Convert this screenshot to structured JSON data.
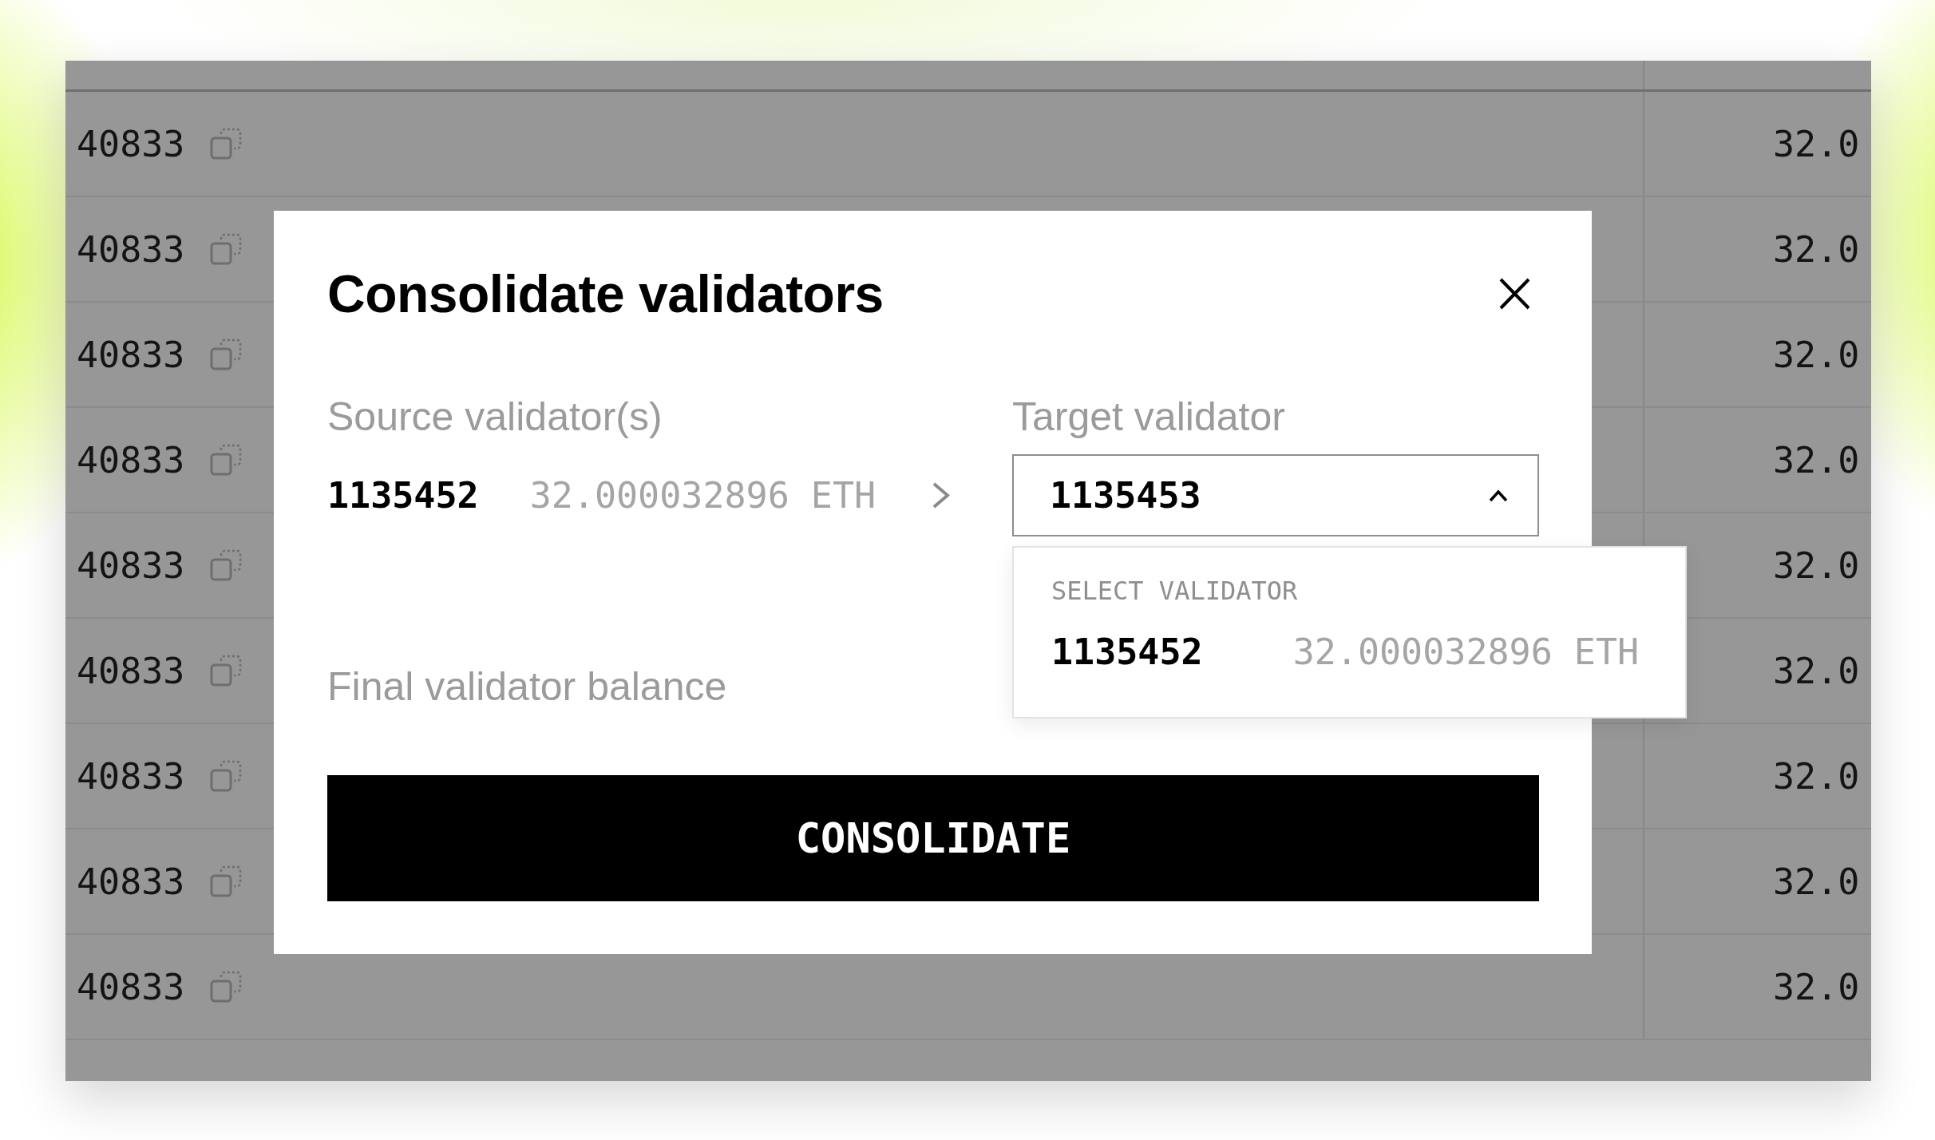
{
  "table": {
    "rows": [
      {
        "column_1": "40833",
        "column_2": "32.0"
      },
      {
        "column_1": "40833",
        "column_2": "32.0"
      },
      {
        "column_1": "40833",
        "column_2": "32.0"
      },
      {
        "column_1": "40833",
        "column_2": "32.0"
      },
      {
        "column_1": "40833",
        "column_2": "32.0"
      },
      {
        "column_1": "40833",
        "column_2": "32.0"
      },
      {
        "column_1": "40833",
        "column_2": "32.0"
      },
      {
        "column_1": "40833",
        "column_2": "32.0"
      },
      {
        "column_1": "40833",
        "column_2": "32.0"
      }
    ]
  },
  "dialog": {
    "title": "Consolidate validators",
    "source": {
      "label": "Source validator(s)",
      "validators": [
        {
          "index": "1135452",
          "balance": "32.000032896 ETH"
        }
      ]
    },
    "target": {
      "label": "Target validator",
      "value": "1135453",
      "expanded": true,
      "menu": {
        "heading": "SELECT VALIDATOR",
        "options": [
          {
            "index": "1135452",
            "balance": "32.000032896 ETH",
            "selected": false
          }
        ]
      }
    },
    "final_balance": {
      "label": "Final validator balance"
    },
    "action": {
      "label": "CONSOLIDATE"
    }
  }
}
